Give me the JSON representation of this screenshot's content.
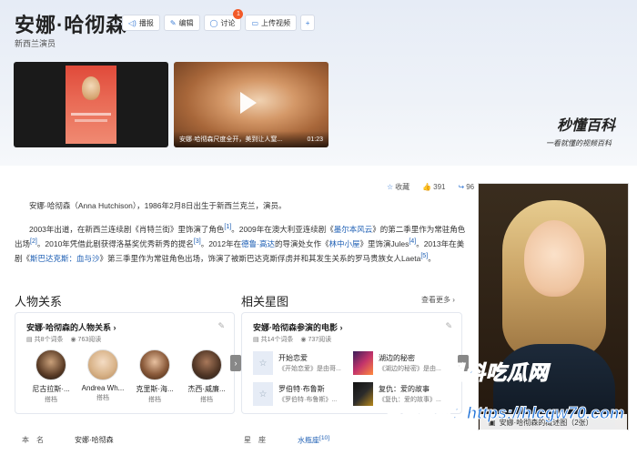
{
  "hero": {
    "title": "安娜·哈彻森",
    "subtitle": "新西兰演员",
    "actions": [
      {
        "label": "播报",
        "icon": "speaker-icon"
      },
      {
        "label": "编辑",
        "icon": "edit-icon"
      },
      {
        "label": "讨论",
        "icon": "chat-icon",
        "badge": "1"
      },
      {
        "label": "上传视频",
        "icon": "video-upload-icon"
      }
    ],
    "video2_caption": "安娜·哈彻森尺度全开，美到让人窒...",
    "video2_duration": "01:23",
    "brand": "秒懂百科",
    "brand_sub": "一看就懂的视频百科"
  },
  "toolbar": {
    "collect": "收藏",
    "likes": "391",
    "shares": "96"
  },
  "intro": {
    "p1": "安娜·哈彻森（Anna Hutchison），1986年2月8日出生于新西兰克兰，演员。",
    "p2_a": "2003年出道，在新西兰连续剧《肖特兰街》里饰演了角色",
    "p2_ref1": "[1]",
    "p2_b": "。2009年在澳大利亚连续剧《",
    "p2_link1": "墨尔本风云",
    "p2_c": "》的第二季里作为常驻角色出场",
    "p2_ref2": "[2]",
    "p2_d": "。2010年凭借此剧获得洛基奖优秀新秀的提名",
    "p2_ref3": "[3]",
    "p2_e": "。2012年在",
    "p2_link2": "德鲁·高达",
    "p2_f": "的导演处女作《",
    "p2_link3": "林中小屋",
    "p2_g": "》里饰演Jules",
    "p2_ref4": "[4]",
    "p2_h": "。2013年在美剧《",
    "p2_link4": "斯巴达克斯：血与沙",
    "p2_i": "》第三季里作为常驻角色出场，饰演了被斯巴达克斯俘虏并和其发生关系的罗马贵族女人Laeta",
    "p2_ref5": "[5]",
    "p2_j": "。"
  },
  "relations": {
    "section_title": "人物关系",
    "card_title": "安娜·哈彻森的人物关系",
    "entries": "共8个词条",
    "views": "763阅读",
    "people": [
      {
        "name": "尼古拉斯·...",
        "role": "搭档"
      },
      {
        "name": "Andrea Wh...",
        "role": "搭档"
      },
      {
        "name": "克里斯·海...",
        "role": "搭档"
      },
      {
        "name": "杰西·威廉...",
        "role": "搭档"
      }
    ]
  },
  "stars": {
    "section_title": "相关星图",
    "more": "查看更多",
    "card_title": "安娜·哈彻森参演的电影",
    "entries": "共14个词条",
    "views": "737阅读",
    "movies": [
      {
        "title": "开始恋爱",
        "sub": "《开始恋爱》是由哥..."
      },
      {
        "title": "湖边的秘密",
        "sub": "《湖边的秘密》是由..."
      },
      {
        "title": "罗伯特·布鲁斯",
        "sub": "《罗伯特·布鲁斯》..."
      },
      {
        "title": "复仇：爱的故事",
        "sub": "《复仇：爱的故事》..."
      }
    ]
  },
  "basic_info": {
    "name_label": "本　名",
    "name_value": "安娜·哈彻森",
    "sign_label": "星　座",
    "sign_value": "水瓶座",
    "sign_ref": "[10]"
  },
  "photo": {
    "caption": "安娜·哈彻森的概述图（2张）"
  },
  "watermark": {
    "line1": "黑料吃瓜网",
    "line2": "看完整版：https://hlcgw70.com"
  },
  "colors": {
    "link": "#1e5fb4",
    "accent": "#3a7bd5",
    "badge": "#f25a29",
    "watermark": "#1b6fd6"
  }
}
